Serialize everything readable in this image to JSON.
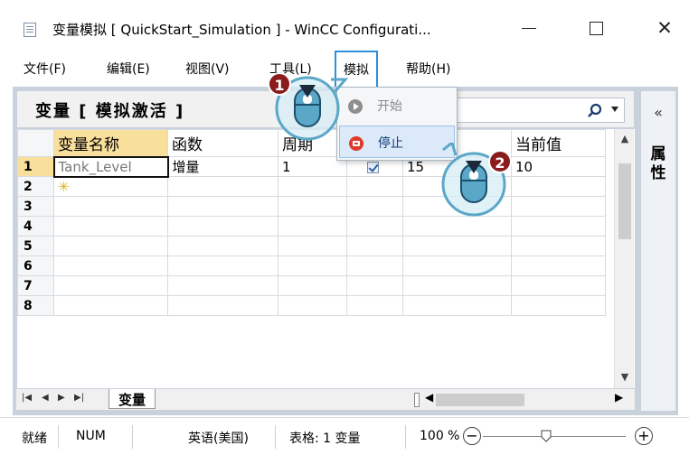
{
  "window": {
    "title": "变量模拟 [ QuickStart_Simulation ] - WinCC Configurati...",
    "minimize_glyph": "—",
    "maximize_glyph": "☐",
    "close_glyph": "✕"
  },
  "menu": {
    "items": [
      {
        "label": "文件(F)"
      },
      {
        "label": "编辑(E)"
      },
      {
        "label": "视图(V)"
      },
      {
        "label": "工具(L)"
      },
      {
        "label": "模拟"
      },
      {
        "label": "帮助(H)"
      }
    ],
    "simulation_menu": {
      "start_label": "开始",
      "stop_label": "停止"
    }
  },
  "panel": {
    "title": "变量 [ 模拟激活 ]",
    "search_value": "",
    "side_title": "属性",
    "collapse_glyph": "«"
  },
  "table": {
    "headers": [
      "变量名称",
      "函数",
      "周期",
      "",
      "",
      "当前值"
    ],
    "rows": [
      {
        "num": "1",
        "name": "Tank_Level",
        "func": "增量",
        "period": "1",
        "checked": true,
        "max": "15",
        "current": "10"
      },
      {
        "num": "2",
        "name": "",
        "func": "",
        "period": "",
        "checked": false,
        "max": "",
        "current": ""
      },
      {
        "num": "3"
      },
      {
        "num": "4"
      },
      {
        "num": "5"
      },
      {
        "num": "6"
      },
      {
        "num": "7"
      },
      {
        "num": "8"
      }
    ],
    "sheet_tab": "变量",
    "nav_glyphs": [
      "|◀",
      "◀",
      "▶",
      "▶|"
    ]
  },
  "statusbar": {
    "ready": "就绪",
    "num": "NUM",
    "language": "英语(美国)",
    "sheet_info": "表格: 1 变量",
    "zoom": "100 %"
  },
  "annotations": {
    "step1": "1",
    "step2": "2"
  },
  "colors": {
    "selection": "#f9df9c",
    "highlight_border": "#2f8fd8",
    "stop_icon": "#e03a2c",
    "callout_badge": "#8a1c1c",
    "mouse_fill": "#5aa7c8"
  }
}
